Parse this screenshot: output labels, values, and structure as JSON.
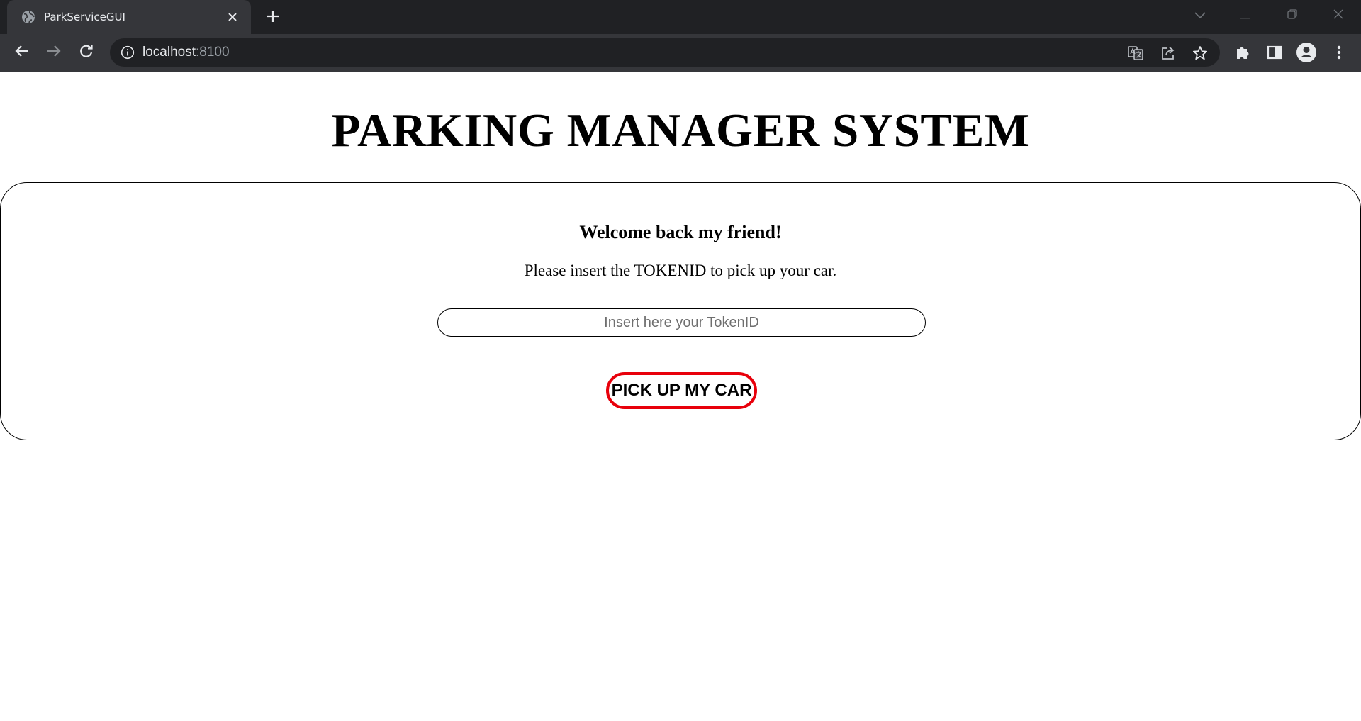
{
  "browser": {
    "tab_title": "ParkServiceGUI",
    "url_host": "localhost",
    "url_port": ":8100",
    "icons": {
      "favicon": "globe-icon",
      "close_tab": "close-icon",
      "new_tab": "plus-icon",
      "back": "arrow-left-icon",
      "forward": "arrow-right-icon",
      "reload": "reload-icon",
      "site_info": "info-icon",
      "translate": "translate-icon",
      "share": "share-icon",
      "bookmark": "star-icon",
      "extensions": "puzzle-icon",
      "side_panel": "side-panel-icon",
      "profile": "profile-icon",
      "menu": "kebab-menu-icon"
    }
  },
  "page": {
    "title": "PARKING MANAGER SYSTEM",
    "welcome": "Welcome back my friend!",
    "instruction": "Please insert the TOKENID to pick up your car.",
    "token_input": {
      "value": "",
      "placeholder": "Insert here your TokenID"
    },
    "pickup_button_label": "PICK UP MY CAR",
    "colors": {
      "button_border": "#e8000b",
      "text": "#000000",
      "background": "#ffffff"
    }
  }
}
